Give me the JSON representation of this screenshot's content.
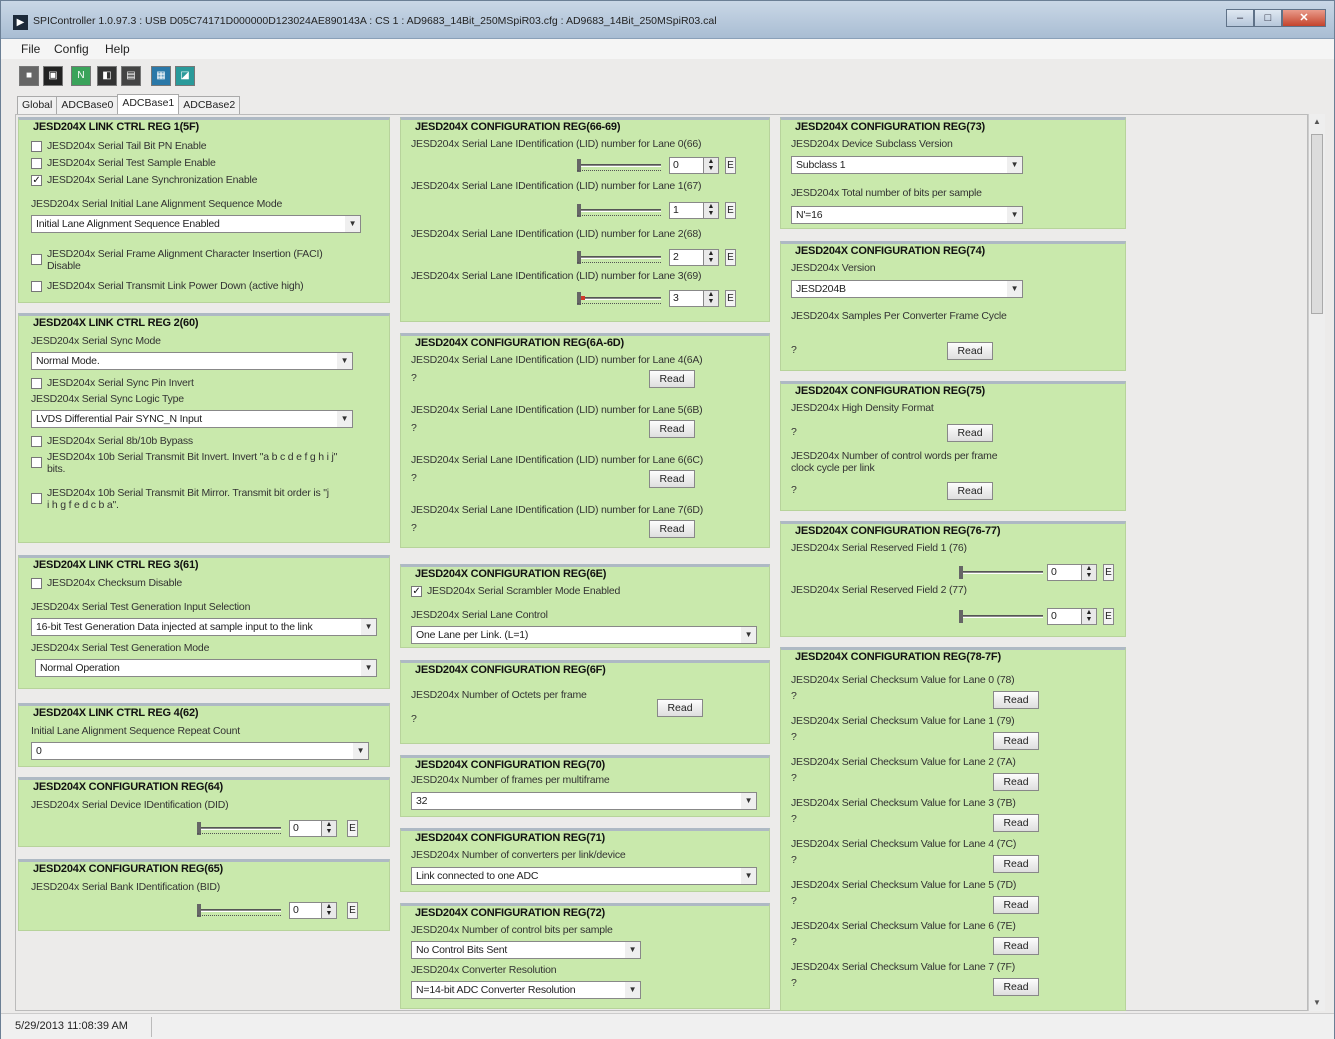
{
  "window": {
    "title": "SPIController 1.0.97.3 : USB D05C74171D000000D123024AE890143A : CS 1 : AD9683_14Bit_250MSpiR03.cfg : AD9683_14Bit_250MSpiR03.cal"
  },
  "menu": [
    "File",
    "Config",
    "Help"
  ],
  "tabs": [
    "Global",
    "ADCBase0",
    "ADCBase1",
    "ADCBase2"
  ],
  "common": {
    "read": "Read",
    "q": "?",
    "e": "E"
  },
  "g1": {
    "title": "JESD204X LINK CTRL REG 1(5F)",
    "cb1": "JESD204x Serial Tail Bit PN Enable",
    "cb2": "JESD204x Serial Test Sample Enable",
    "cb3": "JESD204x Serial Lane Synchronization Enable",
    "ilas_label": "JESD204x Serial Initial Lane Alignment Sequence Mode",
    "ilas_value": "Initial Lane Alignment Sequence Enabled",
    "cb4": "JESD204x Serial Frame Alignment Character Insertion (FACI) Disable",
    "cb5": "JESD204x Serial Transmit Link Power Down (active high)"
  },
  "g2": {
    "title": "JESD204X LINK CTRL REG 2(60)",
    "sync_label": "JESD204x Serial Sync Mode",
    "sync_value": "Normal Mode.",
    "cb1": "JESD204x Serial Sync Pin Invert",
    "logic_label": "JESD204x Serial Sync Logic Type",
    "logic_value": "LVDS Differential Pair SYNC_N Input",
    "cb2": "JESD204x Serial 8b/10b Bypass",
    "cb3": "JESD204x 10b Serial Transmit Bit Invert. Invert \"a b c d e f g h i j\" bits.",
    "cb4": "JESD204x 10b Serial Transmit Bit Mirror. Transmit bit order is \"j i h g f e d c b a\"."
  },
  "g3": {
    "title": "JESD204X LINK CTRL REG 3(61)",
    "cb1": "JESD204x Checksum Disable",
    "sel1_label": "JESD204x Serial Test Generation Input Selection",
    "sel1_value": "16-bit Test Generation Data injected at sample input to the link",
    "sel2_label": "JESD204x Serial Test Generation Mode",
    "sel2_value": "Normal Operation"
  },
  "g4": {
    "title": "JESD204X LINK CTRL REG 4(62)",
    "label": "Initial Lane Alignment Sequence Repeat Count",
    "value": "0"
  },
  "g5": {
    "title": "JESD204X CONFIGURATION REG(64)",
    "label": "JESD204x Serial Device IDentification (DID)",
    "value": "0"
  },
  "g6": {
    "title": "JESD204X CONFIGURATION REG(65)",
    "label": "JESD204x Serial Bank IDentification (BID)",
    "value": "0"
  },
  "g7": {
    "title": "JESD204X CONFIGURATION REG(66-69)",
    "l0": "JESD204x Serial Lane IDentification (LID) number for Lane 0(66)",
    "v0": "0",
    "l1": "JESD204x Serial Lane IDentification (LID) number for Lane 1(67)",
    "v1": "1",
    "l2": "JESD204x Serial Lane IDentification (LID) number for Lane 2(68)",
    "v2": "2",
    "l3": "JESD204x Serial Lane IDentification (LID) number for Lane 3(69)",
    "v3": "3"
  },
  "g8": {
    "title": "JESD204X CONFIGURATION REG(6A-6D)",
    "l4": "JESD204x Serial Lane IDentification (LID) number for Lane 4(6A)",
    "l5": "JESD204x Serial Lane IDentification (LID) number for Lane 5(6B)",
    "l6": "JESD204x Serial Lane IDentification (LID) number for Lane 6(6C)",
    "l7": "JESD204x Serial Lane IDentification (LID) number for Lane 7(6D)"
  },
  "g9": {
    "title": "JESD204X CONFIGURATION REG(6E)",
    "cb1": "JESD204x Serial Scrambler Mode Enabled",
    "lane_label": "JESD204x Serial Lane Control",
    "lane_value": "One Lane per Link.  (L=1)"
  },
  "g10": {
    "title": "JESD204X CONFIGURATION REG(6F)",
    "label": "JESD204x Number of Octets per frame"
  },
  "g11": {
    "title": "JESD204X CONFIGURATION REG(70)",
    "label": "JESD204x Number of frames per multiframe",
    "value": "32"
  },
  "g12": {
    "title": "JESD204X CONFIGURATION REG(71)",
    "label": "JESD204x Number of converters per link/device",
    "value": "Link connected to one ADC"
  },
  "g13": {
    "title": "JESD204X CONFIGURATION REG(72)",
    "l1": "JESD204x Number of control bits per sample",
    "v1": "No Control Bits Sent",
    "l2": "JESD204x Converter Resolution",
    "v2": "N=14-bit ADC Converter Resolution"
  },
  "g14": {
    "title": "JESD204X CONFIGURATION REG(73)",
    "l1": "JESD204x Device Subclass Version",
    "v1": "Subclass 1",
    "l2": "JESD204x Total number of bits per sample",
    "v2": "N'=16"
  },
  "g15": {
    "title": "JESD204X CONFIGURATION REG(74)",
    "l1": "JESD204x Version",
    "v1": "JESD204B",
    "l2": "JESD204x Samples Per Converter Frame Cycle"
  },
  "g16": {
    "title": "JESD204X CONFIGURATION REG(75)",
    "l1": "JESD204x High Density Format",
    "l2": "JESD204x Number of control words per frame clock cycle per link"
  },
  "g17": {
    "title": "JESD204X CONFIGURATION REG(76-77)",
    "l1": "JESD204x Serial Reserved Field 1 (76)",
    "v1": "0",
    "l2": "JESD204x Serial Reserved Field 2 (77)",
    "v2": "0"
  },
  "g18": {
    "title": "JESD204X CONFIGURATION REG(78-7F)",
    "lanes": [
      "JESD204x Serial Checksum Value for Lane 0 (78)",
      "JESD204x Serial Checksum Value for Lane 1 (79)",
      "JESD204x Serial Checksum Value for Lane 2 (7A)",
      "JESD204x Serial Checksum Value for Lane 3 (7B)",
      "JESD204x Serial Checksum Value for Lane 4 (7C)",
      "JESD204x Serial Checksum Value for Lane 5 (7D)",
      "JESD204x Serial Checksum Value for Lane 6 (7E)",
      "JESD204x Serial Checksum Value for Lane 7 (7F)"
    ]
  },
  "status": {
    "time": "5/29/2013 11:08:39 AM"
  },
  "icons": [
    "stop-icon",
    "save-icon",
    "new-icon",
    "display-icon",
    "register-icon",
    "chip-icon",
    "chart-icon"
  ]
}
